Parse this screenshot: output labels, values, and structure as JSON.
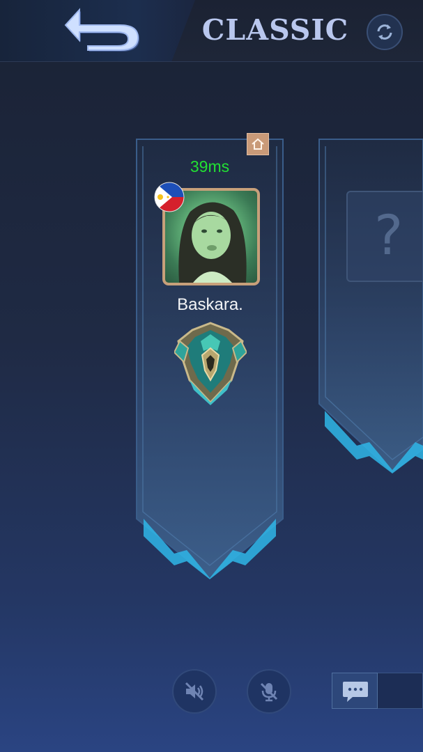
{
  "header": {
    "mode_title": "CLASSIC"
  },
  "player": {
    "ping": "39ms",
    "name": "Baskara.",
    "flag": "philippines-flag"
  },
  "empty_slot": {
    "symbol": "?"
  },
  "icons": {
    "back": "back-arrow-icon",
    "refresh": "refresh-icon",
    "home": "home-icon",
    "speaker_muted": "speaker-muted-icon",
    "mic_muted": "mic-muted-icon",
    "chat": "chat-icon"
  },
  "colors": {
    "ping": "#22e033",
    "title": "#b9c7ee",
    "frame": "#c7a07a",
    "accent": "#2fb6e8"
  }
}
